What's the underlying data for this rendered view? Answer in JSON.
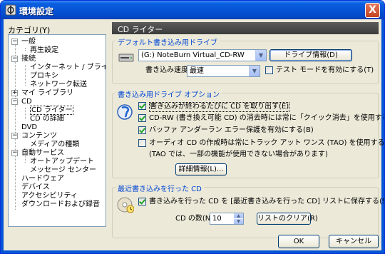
{
  "window": {
    "title": "環境設定",
    "close_label": "X"
  },
  "sidebar": {
    "label": "カテゴリ(Y)",
    "items": [
      {
        "label": "一般",
        "level": 0,
        "expander": "−"
      },
      {
        "label": "再生設定",
        "level": 1
      },
      {
        "label": "接続",
        "level": 0,
        "expander": "−"
      },
      {
        "label": "インターネット / ブライバシー",
        "level": 1
      },
      {
        "label": "プロキシ",
        "level": 1
      },
      {
        "label": "ネットワーク転送",
        "level": 1
      },
      {
        "label": "マイ ライブラリ",
        "level": 0,
        "expander": "+"
      },
      {
        "label": "CD",
        "level": 0,
        "expander": "−"
      },
      {
        "label": "CD ライター",
        "level": 1,
        "selected": true
      },
      {
        "label": "CD の詳細",
        "level": 1
      },
      {
        "label": "DVD",
        "level": 0
      },
      {
        "label": "コンテンツ",
        "level": 0,
        "expander": "−"
      },
      {
        "label": "メディアの種類",
        "level": 1
      },
      {
        "label": "自動サービス",
        "level": 0,
        "expander": "−"
      },
      {
        "label": "オートアップデート",
        "level": 1
      },
      {
        "label": "メッセージ センター",
        "level": 1
      },
      {
        "label": "ハードウェア",
        "level": 0
      },
      {
        "label": "デバイス",
        "level": 0
      },
      {
        "label": "アクセシビリティ",
        "level": 0
      },
      {
        "label": "ダウンロードおよび録音",
        "level": 0
      }
    ]
  },
  "panel": {
    "header": "CD ライター",
    "default_drive": {
      "title": "デフォルト書き込み用ドライブ",
      "drive_value": "(G:) NoteBurn Virtual_CD-RW",
      "drive_info_button": "ドライブ情報(D)",
      "speed_label": "書き込み速度",
      "speed_value": "最速",
      "test_mode_label": "テスト モードを有効にする(T)",
      "test_mode_checked": false
    },
    "drive_options": {
      "title": "書き込み用ドライブ オプション",
      "options": [
        {
          "label": "書き込みが終わるたびに CD を取り出す(E)",
          "checked": true
        },
        {
          "label": "CD-RW (書き換え可能 CD) の消去時には常に「クイック消去」を使用する(U)",
          "checked": true
        },
        {
          "label": "バッファ アンダーラン エラー保護を有効にする(B)",
          "checked": true
        },
        {
          "label": "オーディオ CD の作成時は常にトラック アット ワンス (TAO) を使用する(A)",
          "checked": false
        }
      ],
      "tao_note": "(TAO では、一部の機能が使用できない場合があります)",
      "details_button": "詳細情報(L)..."
    },
    "recent": {
      "title": "最近書き込みを行った CD",
      "add_label": "書き込みを行った CD を [最近書き込みを行った CD] リストに保存する(S)",
      "add_checked": true,
      "count_label": "CD の数(N):",
      "count_value": "10",
      "clear_button": "リストのクリア(R)"
    }
  },
  "footer": {
    "ok": "OK",
    "cancel": "キャンセル"
  }
}
